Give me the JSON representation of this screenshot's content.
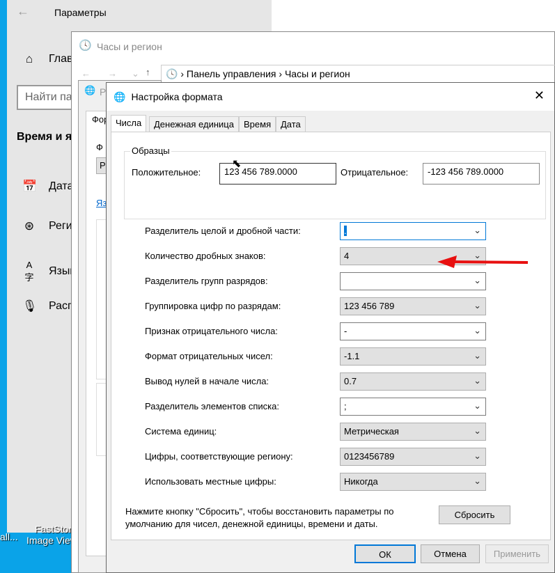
{
  "settings": {
    "title": "Параметры",
    "home": "Главн",
    "search_placeholder": "Найти па",
    "section": "Время и я",
    "items": [
      {
        "label": "Дата",
        "icon": "calendar-icon"
      },
      {
        "label": "Регио",
        "icon": "globe-icon"
      },
      {
        "label": "Язык",
        "icon": "language-icon"
      },
      {
        "label": "Распо",
        "icon": "microphone-icon"
      }
    ]
  },
  "control_panel": {
    "title": "Часы и регион",
    "breadcrumb": [
      "Панель управления",
      "Часы и регион"
    ]
  },
  "region_dialog": {
    "title": "Р",
    "tab": "Фор",
    "field_label": "Ф",
    "field_value": "Р",
    "link": "Яз"
  },
  "desktop": {
    "icon_label_1": "FastStone",
    "icon_label_2": "Image Viewer",
    "icon_label_0": "all..."
  },
  "dialog": {
    "title": "Настройка формата",
    "tabs": [
      "Числа",
      "Денежная единица",
      "Время",
      "Дата"
    ],
    "samples": {
      "group": "Образцы",
      "positive_label": "Положительное:",
      "positive_value": "123 456 789.0000",
      "negative_label": "Отрицательное:",
      "negative_value": "-123 456 789.0000"
    },
    "rows": [
      {
        "label": "Разделитель целой и дробной части:",
        "value": "."
      },
      {
        "label": "Количество дробных знаков:",
        "value": "4"
      },
      {
        "label": "Разделитель групп разрядов:",
        "value": ""
      },
      {
        "label": "Группировка цифр по разрядам:",
        "value": "123 456 789"
      },
      {
        "label": "Признак отрицательного числа:",
        "value": "-"
      },
      {
        "label": "Формат отрицательных чисел:",
        "value": "-1.1"
      },
      {
        "label": "Вывод нулей в начале числа:",
        "value": "0.7"
      },
      {
        "label": "Разделитель элементов списка:",
        "value": ";"
      },
      {
        "label": "Система единиц:",
        "value": "Метрическая"
      },
      {
        "label": "Цифры, соответствующие региону:",
        "value": "0123456789"
      },
      {
        "label": "Использовать местные цифры:",
        "value": "Никогда"
      }
    ],
    "reset_note": "Нажмите кнопку \"Сбросить\", чтобы восстановить параметры по умолчанию для чисел, денежной единицы, времени и даты.",
    "reset": "Сбросить",
    "ok": "ОК",
    "cancel": "Отмена",
    "apply": "Применить"
  },
  "annotation_color": "#e81010"
}
